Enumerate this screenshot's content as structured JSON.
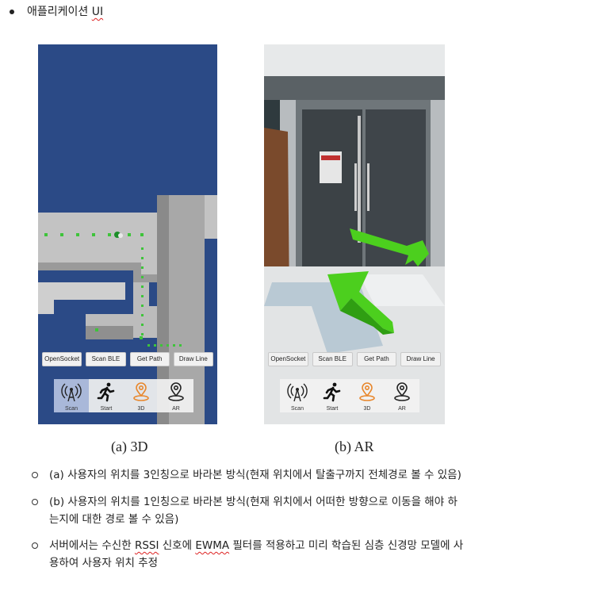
{
  "heading": {
    "text_main": "애플리케이션 ",
    "text_ui": "UI"
  },
  "panels": {
    "left": {
      "buttons": [
        "OpenSocket",
        "Scan BLE",
        "Get Path",
        "Draw Line"
      ],
      "modes": [
        "Scan",
        "Start",
        "3D",
        "AR"
      ],
      "selected_mode": "Scan"
    },
    "right": {
      "buttons": [
        "OpenSocket",
        "Scan BLE",
        "Get Path",
        "Draw Line"
      ],
      "modes": [
        "Scan",
        "Start",
        "3D",
        "AR"
      ]
    }
  },
  "captions": {
    "a": "(a)  3D",
    "b": "(b)  AR"
  },
  "items": [
    {
      "line1": "(a) 사용자의 위치를 3인칭으로 바라본 방식(현재 위치에서 탈출구까지 전체경로 볼 수 있음)"
    },
    {
      "line1": "(b) 사용자의 위치를 1인칭으로 바라본 방식(현재 위치에서 어떠한 방향으로 이동을 해야 하",
      "line2": "는지에 대한 경로 볼 수 있음)"
    },
    {
      "pre": "서버에서는 수신한 ",
      "rssi": "RSSI",
      "mid": " 신호에 ",
      "ewma": "EWMA",
      "post": " 필터를 적용하고 미리 학습된 심층 신경망 모델에 사",
      "line2": "용하여 사용자 위치 추정"
    }
  ],
  "colors": {
    "map_background": "#2b4a86",
    "path_green": "#3ec43a",
    "arrow_green": "#4ccf1e",
    "orange_icon": "#e8872c"
  }
}
